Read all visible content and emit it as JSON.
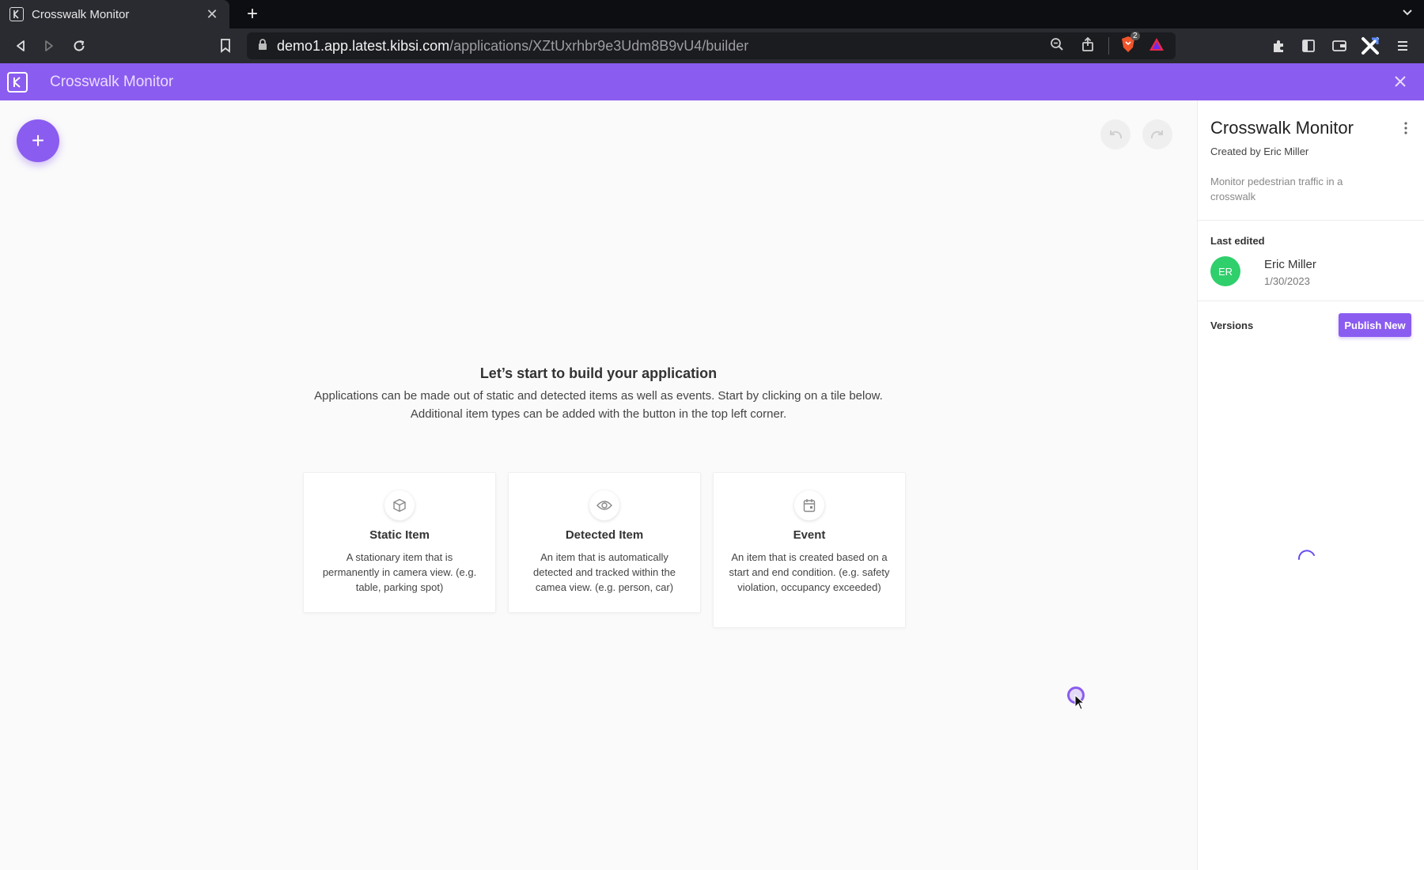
{
  "browser": {
    "tab_title": "Crosswalk Monitor",
    "url_host": "demo1.app.latest.kibsi.com",
    "url_path": "/applications/XZtUxrhbr9e3Udm8B9vU4/builder",
    "shield_badge": "2"
  },
  "header": {
    "title": "Crosswalk Monitor"
  },
  "canvas": {
    "empty_title": "Let’s start to build your application",
    "empty_desc_line1": "Applications can be made out of static and detected items as well as events. Start by clicking on a tile below.",
    "empty_desc_line2": "Additional item types can be added with the button in the top left corner.",
    "tiles": [
      {
        "name": "Static Item",
        "icon": "cube-icon",
        "desc": "A stationary item that is permanently in camera view. (e.g. table, parking spot)"
      },
      {
        "name": "Detected Item",
        "icon": "eye-icon",
        "desc": "An item that is automatically detected and tracked within the camea view. (e.g. person, car)"
      },
      {
        "name": "Event",
        "icon": "calendar-icon",
        "desc": "An item that is created based on a start and end condition. (e.g. safety violation, occupancy exceeded)"
      }
    ]
  },
  "panel": {
    "title": "Crosswalk Monitor",
    "created_by": "Created by Eric Miller",
    "description": "Monitor pedestrian traffic in a crosswalk",
    "last_edited_label": "Last edited",
    "editor_initials": "ER",
    "editor_name": "Eric Miller",
    "edited_date": "1/30/2023",
    "versions_label": "Versions",
    "publish_label": "Publish New"
  },
  "colors": {
    "accent": "#8b5cf0",
    "avatar": "#2fcf6b"
  }
}
